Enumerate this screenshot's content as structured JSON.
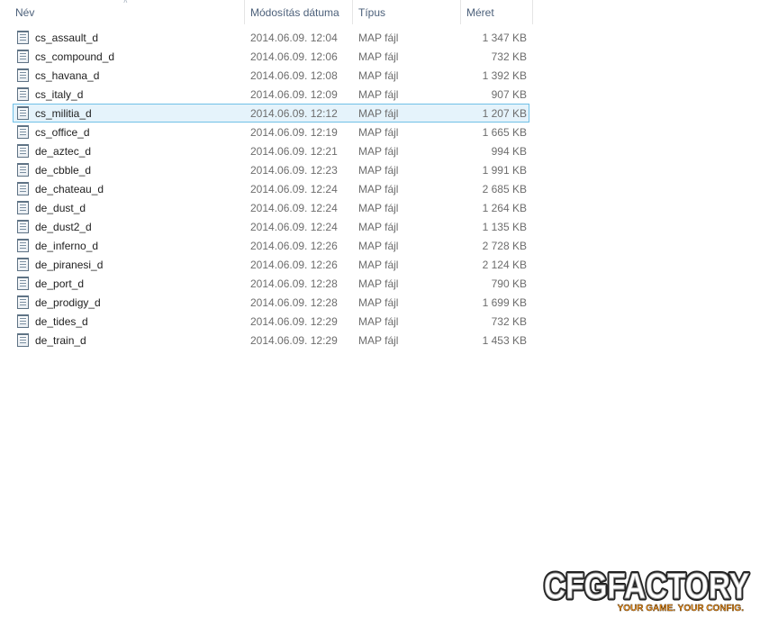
{
  "columns": {
    "name": "Név",
    "date": "Módosítás dátuma",
    "type": "Típus",
    "size": "Méret"
  },
  "files": [
    {
      "name": "cs_assault_d",
      "date": "2014.06.09. 12:04",
      "type": "MAP fájl",
      "size": "1 347 KB"
    },
    {
      "name": "cs_compound_d",
      "date": "2014.06.09. 12:06",
      "type": "MAP fájl",
      "size": "732 KB"
    },
    {
      "name": "cs_havana_d",
      "date": "2014.06.09. 12:08",
      "type": "MAP fájl",
      "size": "1 392 KB"
    },
    {
      "name": "cs_italy_d",
      "date": "2014.06.09. 12:09",
      "type": "MAP fájl",
      "size": "907 KB"
    },
    {
      "name": "cs_militia_d",
      "date": "2014.06.09. 12:12",
      "type": "MAP fájl",
      "size": "1 207 KB",
      "selected": true
    },
    {
      "name": "cs_office_d",
      "date": "2014.06.09. 12:19",
      "type": "MAP fájl",
      "size": "1 665 KB"
    },
    {
      "name": "de_aztec_d",
      "date": "2014.06.09. 12:21",
      "type": "MAP fájl",
      "size": "994 KB"
    },
    {
      "name": "de_cbble_d",
      "date": "2014.06.09. 12:23",
      "type": "MAP fájl",
      "size": "1 991 KB"
    },
    {
      "name": "de_chateau_d",
      "date": "2014.06.09. 12:24",
      "type": "MAP fájl",
      "size": "2 685 KB"
    },
    {
      "name": "de_dust_d",
      "date": "2014.06.09. 12:24",
      "type": "MAP fájl",
      "size": "1 264 KB"
    },
    {
      "name": "de_dust2_d",
      "date": "2014.06.09. 12:24",
      "type": "MAP fájl",
      "size": "1 135 KB"
    },
    {
      "name": "de_inferno_d",
      "date": "2014.06.09. 12:26",
      "type": "MAP fájl",
      "size": "2 728 KB"
    },
    {
      "name": "de_piranesi_d",
      "date": "2014.06.09. 12:26",
      "type": "MAP fájl",
      "size": "2 124 KB"
    },
    {
      "name": "de_port_d",
      "date": "2014.06.09. 12:28",
      "type": "MAP fájl",
      "size": "790 KB"
    },
    {
      "name": "de_prodigy_d",
      "date": "2014.06.09. 12:28",
      "type": "MAP fájl",
      "size": "1 699 KB"
    },
    {
      "name": "de_tides_d",
      "date": "2014.06.09. 12:29",
      "type": "MAP fájl",
      "size": "732 KB"
    },
    {
      "name": "de_train_d",
      "date": "2014.06.09. 12:29",
      "type": "MAP fájl",
      "size": "1 453 KB"
    }
  ],
  "logo": {
    "brand": "CFGFACTORY",
    "tagline": "YOUR GAME. YOUR CONFIG."
  },
  "colors": {
    "selection_bg": "#e5f3fb",
    "selection_border": "#70c0e7",
    "header_text": "#4c607a",
    "logo_accent": "#f7941d"
  },
  "icons": {
    "file": "map-file-icon",
    "sort": "sort-ascending-icon"
  }
}
